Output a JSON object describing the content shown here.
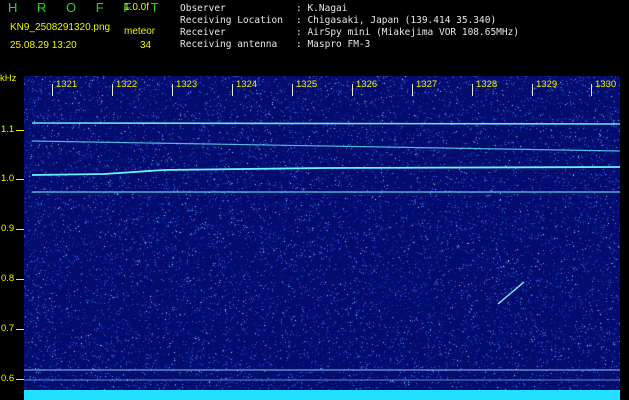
{
  "header": {
    "brand": "H R O F F T",
    "version": "1.0.0f",
    "filename": "KN9_2508291320.png",
    "mode": "meteor",
    "datetime": "25.08.29 13:20",
    "count": "34",
    "labels": {
      "observer": "Observer",
      "location": "Receiving Location",
      "receiver": "Receiver",
      "antenna": "Receiving antenna"
    },
    "values": {
      "observer": ": K.Nagai",
      "location": ": Chigasaki, Japan (139.414 35.340)",
      "receiver": ": AirSpy mini (Miakejima VOR 108.65MHz)",
      "antenna": ": Maspro FM-3"
    }
  },
  "spectrogram": {
    "y_unit": "kHz",
    "y_ticks": [
      "1.1",
      "1.0",
      "0.9",
      "0.8",
      "0.7",
      "0.6"
    ],
    "x_ticks": [
      "1321",
      "1322",
      "1323",
      "1324",
      "1325",
      "1326",
      "1327",
      "1328",
      "1329",
      "1330"
    ],
    "colors": {
      "background": "#040c6e",
      "signal": "#6ff0ff",
      "noise_floor": "#22e0ff",
      "axis_text": "#f2f200"
    }
  }
}
